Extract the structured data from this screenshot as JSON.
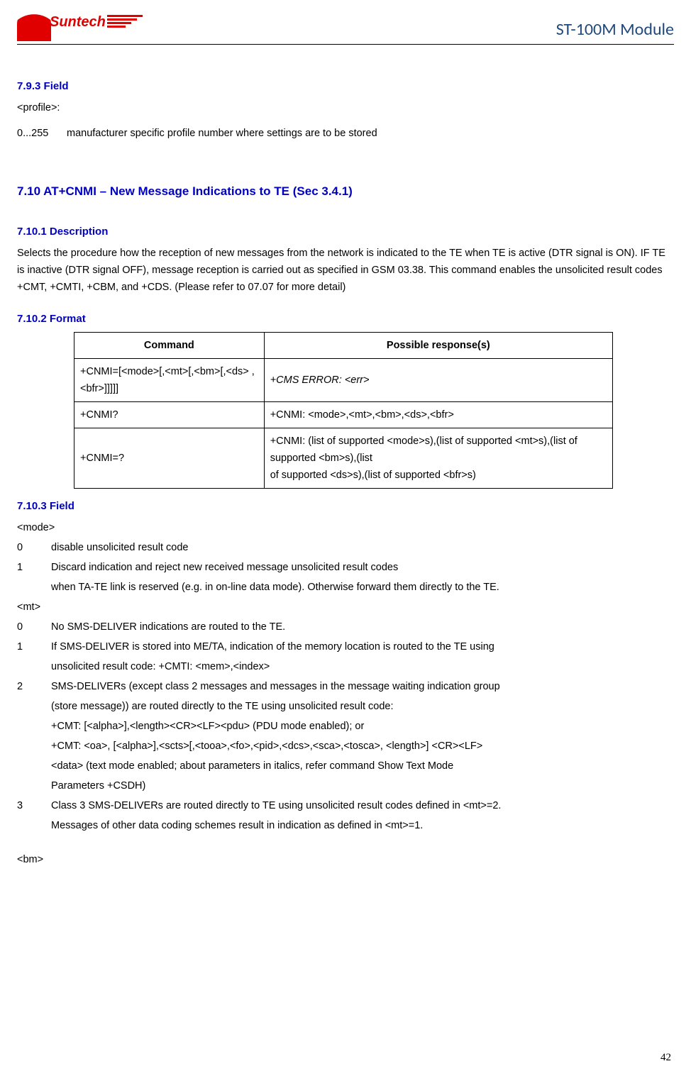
{
  "header": {
    "logo_text": "Suntech",
    "title": "ST-100M Module"
  },
  "sec793": {
    "heading": "7.9.3 Field",
    "line1": "<profile>:",
    "row_key": "0...255",
    "row_val": "manufacturer specific profile number where settings are to be stored"
  },
  "sec710": {
    "heading": "7.10 AT+CNMI – New Message Indications to TE (Sec 3.4.1)"
  },
  "sec7101": {
    "heading": "7.10.1 Description",
    "body": "Selects the procedure how the reception of new messages from the network is indicated to the TE when TE is active (DTR signal is ON). IF TE is inactive (DTR signal OFF), message reception is carried out as specified in GSM 03.38. This command enables the unsolicited result codes +CMT, +CMTI, +CBM, and +CDS. (Please refer to 07.07 for more detail)"
  },
  "sec7102": {
    "heading": "7.10.2 Format",
    "th1": "Command",
    "th2": "Possible response(s)",
    "r1c1": "+CNMI=[<mode>[,<mt>[,<bm>[,<ds> ,<bfr>]]]]]",
    "r1c2": "+CMS ERROR: <err>",
    "r2c1": "+CNMI?",
    "r2c2": "+CNMI: <mode>,<mt>,<bm>,<ds>,<bfr>",
    "r3c1": "+CNMI=?",
    "r3c2": "+CNMI: (list of supported <mode>s),(list of supported <mt>s),(list of supported <bm>s),(list\nof supported <ds>s),(list of supported <bfr>s)"
  },
  "sec7103": {
    "heading": "7.10.3 Field",
    "mode_label": "<mode>",
    "mode0_key": "0",
    "mode0_val": "disable unsolicited result code",
    "mode1_key": "1",
    "mode1_val": "Discard indication and reject new received message unsolicited result codes",
    "mode1_cont": "when TA-TE link is reserved (e.g. in on-line data mode). Otherwise forward them directly to the TE.",
    "mt_label": "<mt>",
    "mt0_key": "0",
    "mt0_val": "No SMS-DELIVER indications are routed to the TE.",
    "mt1_key": "1",
    "mt1_val": "If SMS-DELIVER is stored into ME/TA, indication of the memory location is routed to the TE using",
    "mt1_cont": "unsolicited result code: +CMTI: <mem>,<index>",
    "mt2_key": "2",
    "mt2_val": "SMS-DELIVERs (except class 2 messages and messages in the message waiting indication group",
    "mt2_c1": "(store message)) are routed directly to the TE using unsolicited result code:",
    "mt2_c2": "+CMT: [<alpha>],<length><CR><LF><pdu> (PDU mode enabled); or",
    "mt2_c3": "+CMT: <oa>, [<alpha>],<scts>[,<tooa>,<fo>,<pid>,<dcs>,<sca>,<tosca>, <length>] <CR><LF>",
    "mt2_c4": "<data> (text mode enabled; about parameters in italics, refer command Show Text Mode",
    "mt2_c5": "Parameters +CSDH)",
    "mt3_key": "3",
    "mt3_val": "Class 3 SMS-DELIVERs are routed directly to TE using unsolicited result codes defined in <mt>=2.",
    "mt3_cont": "Messages of other data coding schemes result in indication as defined in <mt>=1.",
    "bm_label": "<bm>"
  },
  "page_number": "42"
}
